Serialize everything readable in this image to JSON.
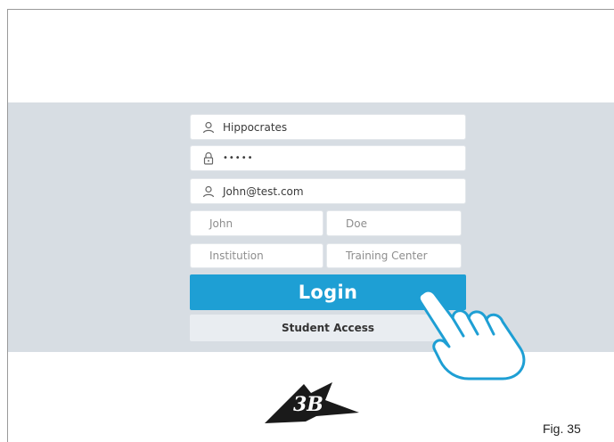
{
  "form": {
    "username": "Hippocrates",
    "password_mask": "•••••",
    "email": "John@test.com",
    "first_name": "John",
    "last_name": "Doe",
    "institution_placeholder": "Institution",
    "training_center_placeholder": "Training Center"
  },
  "buttons": {
    "login": "Login",
    "student_access": "Student Access"
  },
  "logo_text": "3B",
  "caption": "Fig. 35",
  "colors": {
    "accent": "#1e9fd4",
    "band": "#d7dde3",
    "secondary_button": "#e9edf1"
  },
  "icons": [
    "user-icon",
    "lock-icon",
    "user-icon",
    "hand-pointer-icon"
  ]
}
